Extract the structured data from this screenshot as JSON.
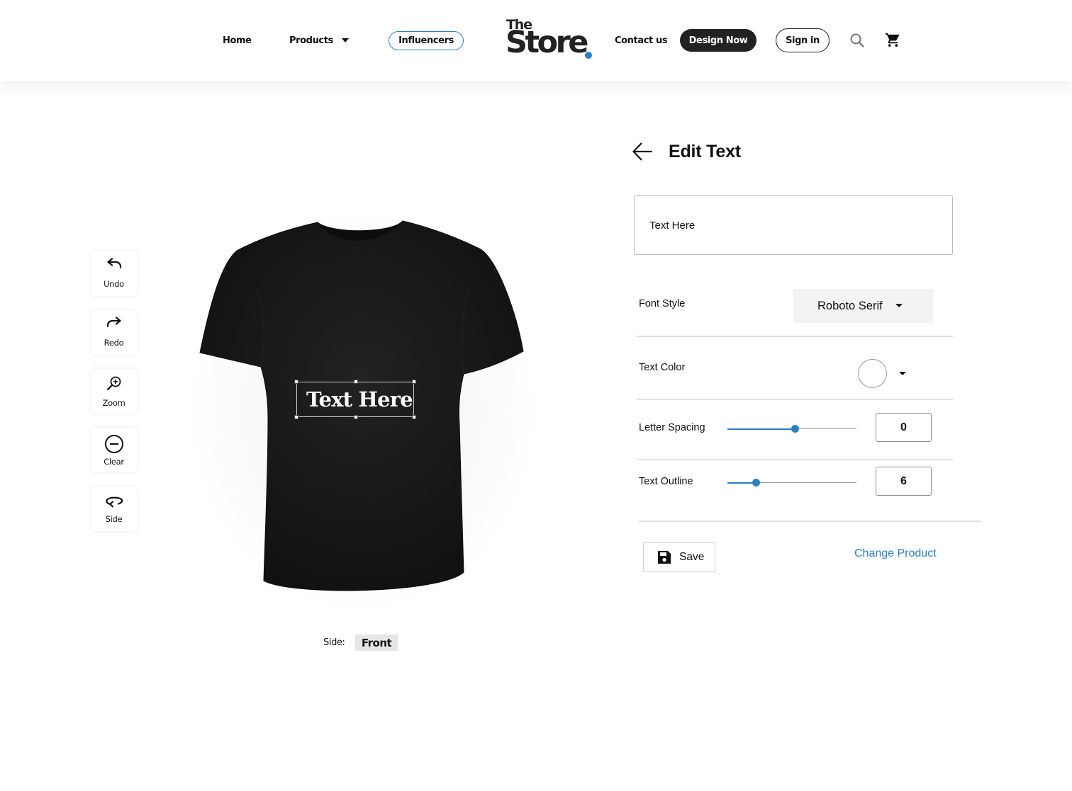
{
  "nav": {
    "home": "Home",
    "products": "Products",
    "influencers": "Influencers",
    "contact": "Contact us",
    "design_now": "Design Now",
    "sign_in": "Sign in"
  },
  "logo": {
    "line1": "The",
    "line2": "Store"
  },
  "icons": {
    "search": "search-icon",
    "cart": "cart-icon",
    "back": "arrow-left-icon",
    "save": "floppy-disk-icon"
  },
  "toolbar": [
    {
      "label": "Undo",
      "icon": "undo-icon"
    },
    {
      "label": "Redo",
      "icon": "redo-icon"
    },
    {
      "label": "Zoom",
      "icon": "zoom-in-icon"
    },
    {
      "label": "Clear",
      "icon": "minus-circle-icon"
    },
    {
      "label": "Side",
      "icon": "rotate-icon"
    }
  ],
  "canvas": {
    "print_text": "Text Here",
    "side_label": "Side:",
    "side_value": "Front"
  },
  "panel": {
    "title": "Edit Text",
    "text_value": "Text Here",
    "font_style_label": "Font Style",
    "font_style_value": "Roboto Serif",
    "text_color_label": "Text Color",
    "text_color_value": "#ffffff",
    "letter_spacing_label": "Letter Spacing",
    "letter_spacing_value": "0",
    "letter_spacing_fraction": 0.52,
    "text_outline_label": "Text Outline",
    "text_outline_value": "6",
    "text_outline_fraction": 0.22,
    "save_label": "Save",
    "change_product_label": "Change Product"
  },
  "colors": {
    "accent": "#2a7fc4",
    "dark_button": "#222222",
    "shirt": "#161616"
  }
}
